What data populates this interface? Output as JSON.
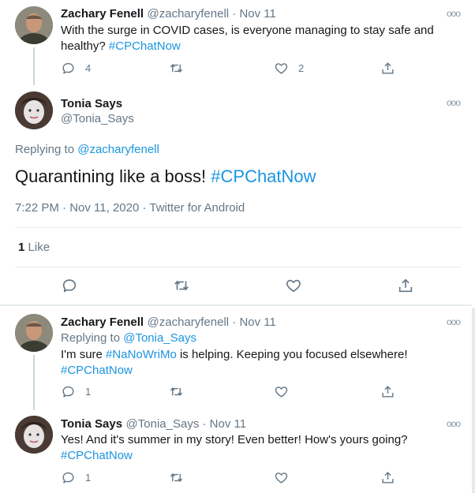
{
  "tweet1": {
    "name": "Zachary Fenell",
    "handle_time": "@zacharyfenell · Nov 11",
    "text": "With the surge in COVID cases, is everyone managing to stay safe and healthy?",
    "hashtag": "#CPChatNow",
    "reply_count": "4",
    "like_count": "2"
  },
  "main": {
    "name": "Tonia Says",
    "handle": "@Tonia_Says",
    "replying_label": "Replying to",
    "replying_to": "@zacharyfenell",
    "text": "Quarantining like a boss!",
    "hashtag": "#CPChatNow",
    "timestamp": "7:22 PM · Nov 11, 2020 · Twitter for Android",
    "likes_count": "1",
    "likes_label": "Like"
  },
  "reply1": {
    "name": "Zachary Fenell",
    "handle_time": "@zacharyfenell · Nov 11",
    "replying_label": "Replying to",
    "replying_to": "@Tonia_Says",
    "text_pre": "I'm sure",
    "hashtag1": "#NaNoWriMo",
    "text_post": "is helping. Keeping you focused elsewhere!",
    "hashtag2": "#CPChatNow",
    "reply_count": "1"
  },
  "reply2": {
    "name": "Tonia Says",
    "handle_time": "@Tonia_Says · Nov 11",
    "text": "Yes! And it's summer in my story! Even better!  How's yours going?",
    "hashtag": "#CPChatNow",
    "reply_count": "1"
  },
  "icons": {
    "more": "ooo",
    "reply": "reply-icon",
    "retweet": "retweet-icon",
    "like": "heart-icon",
    "share": "share-icon"
  },
  "colors": {
    "link": "#1b95e0",
    "secondary_text": "#657786",
    "divider": "#e6ecf0"
  }
}
